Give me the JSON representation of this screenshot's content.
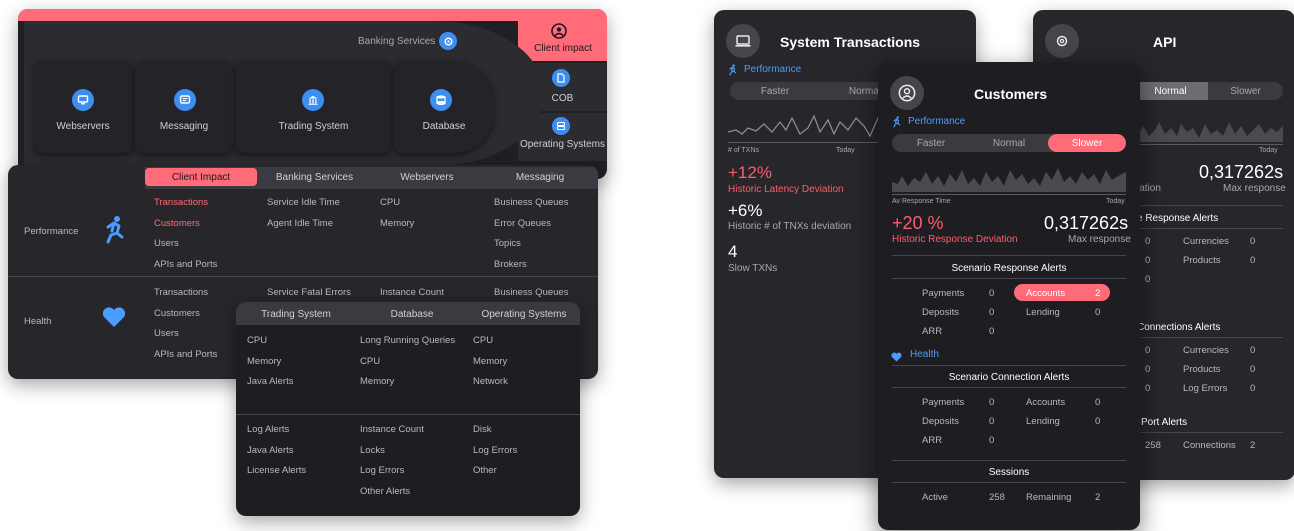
{
  "overview": {
    "header": "Banking Services",
    "client_impact": "Client impact",
    "nodes": [
      "Webservers",
      "Messaging",
      "Trading System",
      "Database"
    ],
    "right_nodes": [
      "COB",
      "Operating Systems"
    ]
  },
  "matrix": {
    "tabs": [
      "Client Impact",
      "Banking Services",
      "Webservers",
      "Messaging"
    ],
    "perf_label": "Performance",
    "health_label": "Health",
    "perf_col1": [
      "Transactions",
      "Customers",
      "Users",
      "APIs and Ports"
    ],
    "perf_col2": [
      "Service Idle Time",
      "Agent Idle Time"
    ],
    "perf_col3": [
      "CPU",
      "Memory"
    ],
    "perf_col4": [
      "Business Queues",
      "Error Queues",
      "Topics",
      "Brokers"
    ],
    "health_col1": [
      "Transactions",
      "Customers",
      "Users",
      "APIs and Ports"
    ],
    "health_col2": [
      "Service Fatal Errors"
    ],
    "health_col3": [
      "Instance Count"
    ],
    "health_col4": [
      "Business Queues"
    ]
  },
  "infra": {
    "tabs": [
      "Trading System",
      "Database",
      "Operating Systems"
    ],
    "top_col1": [
      "CPU",
      "Memory",
      "Java Alerts"
    ],
    "top_col2": [
      "Long Running Queries",
      "CPU",
      "Memory"
    ],
    "top_col3": [
      "CPU",
      "Memory",
      "Network"
    ],
    "bot_col1": [
      "Log Alerts",
      "Java Alerts",
      "License Alerts"
    ],
    "bot_col2": [
      "Instance Count",
      "Locks",
      "Log Errors",
      "Other Alerts"
    ],
    "bot_col3": [
      "Disk",
      "Log Errors",
      "Other"
    ]
  },
  "systx": {
    "title": "System Transactions",
    "perf": "Performance",
    "seg": [
      "Faster",
      "Normal"
    ],
    "x_left": "# of TXNs",
    "x_right": "Today",
    "m1_value": "+12%",
    "m1_label": "Historic Latency Deviation",
    "m2_value": "+6%",
    "m2_label": "Historic # of TNXs deviation",
    "m3_value": "4",
    "m3_label": "Slow TXNs"
  },
  "api": {
    "title": "API",
    "seg": [
      "Normal",
      "Slower"
    ],
    "x_right": "Today",
    "value": "0,317262s",
    "value_label": "Max response",
    "left_cut": "iation",
    "sec1": "e Response Alerts",
    "sec1_rows": [
      [
        "0",
        "Currencies",
        "0"
      ],
      [
        "0",
        "Products",
        "0"
      ],
      [
        "0",
        "",
        ""
      ]
    ],
    "sec2": "Connections Alerts",
    "sec2_rows": [
      [
        "0",
        "Currencies",
        "0"
      ],
      [
        "0",
        "Products",
        "0"
      ],
      [
        "0",
        "Log Errors",
        "0"
      ]
    ],
    "sec3": "Port Alerts",
    "sec3_rows": [
      [
        "258",
        "Connections",
        "2"
      ]
    ]
  },
  "customers": {
    "title": "Customers",
    "perf": "Performance",
    "seg": [
      "Faster",
      "Normal",
      "Slower"
    ],
    "x_left": "Av Response Time",
    "x_right": "Today",
    "m1_value": "+20 %",
    "m1_label": "Historic Response Deviation",
    "m2_value": "0,317262s",
    "m2_label": "Max response",
    "sec1": "Scenario Response Alerts",
    "r1": [
      "Payments",
      "0",
      "Accounts",
      "2"
    ],
    "r2": [
      "Deposits",
      "0",
      "Lending",
      "0"
    ],
    "r3": [
      "ARR",
      "0"
    ],
    "health": "Health",
    "sec2": "Scenario Connection Alerts",
    "c1": [
      "Payments",
      "0",
      "Accounts",
      "0"
    ],
    "c2": [
      "Deposits",
      "0",
      "Lending",
      "0"
    ],
    "c3": [
      "ARR",
      "0"
    ],
    "sec3": "Sessions",
    "s1": [
      "Active",
      "258",
      "Remaining",
      "2"
    ]
  },
  "colors": {
    "accent": "#ff6b78",
    "blue": "#3d8ef0",
    "card": "#26262b"
  }
}
